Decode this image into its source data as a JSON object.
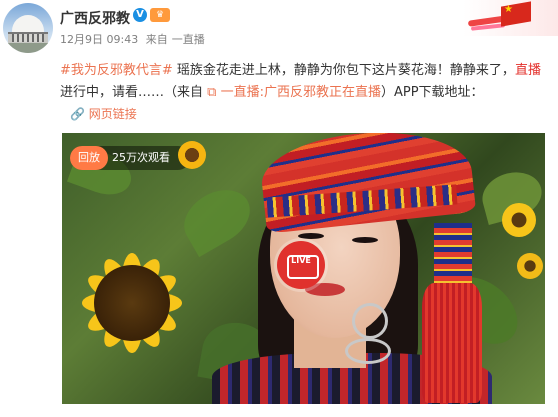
{
  "account": {
    "name": "广西反邪教",
    "verified_icon": "verified-v-icon",
    "level_icon": "vip-badge-icon"
  },
  "meta": {
    "date": "12月9日 09:43",
    "source_prefix": "来自",
    "source": "一直播"
  },
  "post": {
    "hashtag": "#我为反邪教代言#",
    "text1": " 瑶族金花走进上林，静静为你包下这片葵花海！静静来了，",
    "live_word": "直播",
    "text2": "进行中，请看……（来自 ",
    "live_link": "一直播:广西反邪教正在直播",
    "text3": "）APP下载地址：",
    "web_link": "网页链接"
  },
  "video": {
    "replay_label": "回放",
    "viewers": "25万次观看",
    "live_badge": "LIVE"
  }
}
